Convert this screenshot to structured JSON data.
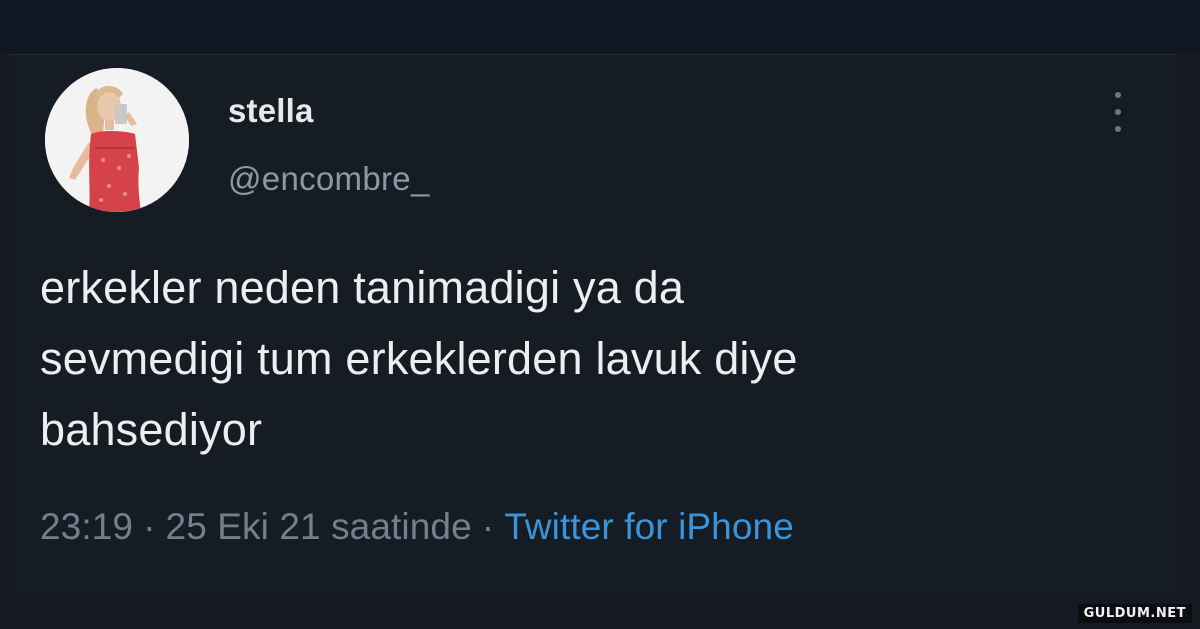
{
  "tweet": {
    "author": {
      "display_name": "stella",
      "handle": "@encombre_"
    },
    "text_lines": [
      "erkekler neden tanimadigi ya da",
      "sevmedigi tum erkeklerden lavuk diye",
      "bahsediyor"
    ],
    "meta": {
      "time": "23:19",
      "date_phrase": "25 Eki 21 saatinde",
      "separator": "·",
      "source": "Twitter for iPhone"
    }
  },
  "watermark": "GULDUM.NET",
  "colors": {
    "background": "#151a22",
    "text_primary": "#e7e9ea",
    "text_secondary": "#8b98a5",
    "link": "#3b94d9"
  },
  "icons": {
    "more_options": "more-vertical-icon"
  }
}
